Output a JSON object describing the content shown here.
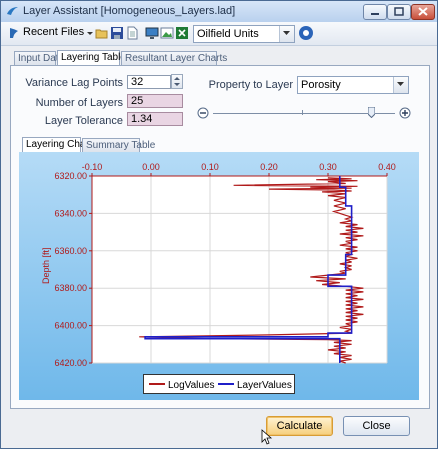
{
  "window": {
    "title": "Layer Assistant [Homogeneous_Layers.lad]"
  },
  "toolbar": {
    "recent_files_label": "Recent Files",
    "units_value": "Oilfield Units"
  },
  "main_tabs": [
    "Input Data",
    "Layering Tables",
    "Resultant Layer Charts"
  ],
  "form": {
    "variance_lag_label": "Variance Lag Points",
    "variance_lag_value": "32",
    "num_layers_label": "Number of Layers",
    "num_layers_value": "25",
    "layer_tolerance_label": "Layer Tolerance",
    "layer_tolerance_value": "1.34",
    "property_label": "Property to Layer",
    "property_value": "Porosity",
    "slider_level": 0.87
  },
  "sub_tabs": [
    "Layering Chart",
    "Summary Table"
  ],
  "chart_data": {
    "type": "line",
    "ylabel": "Depth [ft]",
    "xlabel": "",
    "xlim": [
      -0.1,
      0.4
    ],
    "ylim": [
      6320,
      6420
    ],
    "y_inverted": true,
    "x_ticks": [
      "-0.10",
      "0.00",
      "0.10",
      "0.20",
      "0.30",
      "0.40"
    ],
    "y_ticks": [
      "6320.00",
      "6340.00",
      "6360.00",
      "6380.00",
      "6400.00",
      "6420.00"
    ],
    "grid": true,
    "legend_position": "bottom",
    "series": [
      {
        "name": "LogValues",
        "color": "#b01a1a",
        "points": [
          [
            0.3,
            6321
          ],
          [
            0.34,
            6321.5
          ],
          [
            0.28,
            6322
          ],
          [
            0.35,
            6322.5
          ],
          [
            0.3,
            6323
          ],
          [
            0.33,
            6324
          ],
          [
            0.14,
            6325
          ],
          [
            0.35,
            6325.5
          ],
          [
            0.27,
            6326
          ],
          [
            0.34,
            6326.5
          ],
          [
            0.2,
            6327
          ],
          [
            0.31,
            6327.5
          ],
          [
            0.34,
            6328
          ],
          [
            0.29,
            6328.5
          ],
          [
            0.33,
            6329.5
          ],
          [
            0.3,
            6330.5
          ],
          [
            0.33,
            6331.5
          ],
          [
            0.31,
            6333
          ],
          [
            0.33,
            6334.5
          ],
          [
            0.31,
            6336
          ],
          [
            0.33,
            6337.5
          ],
          [
            0.31,
            6339
          ],
          [
            0.33,
            6341
          ],
          [
            0.34,
            6342
          ],
          [
            0.33,
            6343
          ],
          [
            0.34,
            6344
          ],
          [
            0.32,
            6345
          ],
          [
            0.35,
            6346
          ],
          [
            0.33,
            6347
          ],
          [
            0.36,
            6348
          ],
          [
            0.33,
            6349
          ],
          [
            0.35,
            6350
          ],
          [
            0.32,
            6351
          ],
          [
            0.36,
            6352
          ],
          [
            0.33,
            6353
          ],
          [
            0.35,
            6354
          ],
          [
            0.33,
            6355
          ],
          [
            0.34,
            6356
          ],
          [
            0.32,
            6357
          ],
          [
            0.35,
            6358
          ],
          [
            0.33,
            6359
          ],
          [
            0.35,
            6360
          ],
          [
            0.33,
            6361
          ],
          [
            0.34,
            6362
          ],
          [
            0.33,
            6363
          ],
          [
            0.35,
            6364
          ],
          [
            0.33,
            6365
          ],
          [
            0.34,
            6366
          ],
          [
            0.32,
            6367
          ],
          [
            0.34,
            6368
          ],
          [
            0.33,
            6369
          ],
          [
            0.34,
            6370
          ],
          [
            0.32,
            6371
          ],
          [
            0.33,
            6372
          ],
          [
            0.3,
            6373
          ],
          [
            0.27,
            6374
          ],
          [
            0.33,
            6375
          ],
          [
            0.28,
            6376
          ],
          [
            0.32,
            6377
          ],
          [
            0.29,
            6378
          ],
          [
            0.33,
            6379
          ],
          [
            0.36,
            6380
          ],
          [
            0.33,
            6381
          ],
          [
            0.36,
            6382
          ],
          [
            0.33,
            6383
          ],
          [
            0.35,
            6384
          ],
          [
            0.33,
            6385
          ],
          [
            0.36,
            6386
          ],
          [
            0.33,
            6387
          ],
          [
            0.35,
            6388
          ],
          [
            0.33,
            6389
          ],
          [
            0.36,
            6390
          ],
          [
            0.33,
            6391
          ],
          [
            0.35,
            6392
          ],
          [
            0.33,
            6393
          ],
          [
            0.36,
            6394
          ],
          [
            0.33,
            6395
          ],
          [
            0.35,
            6396
          ],
          [
            0.33,
            6397
          ],
          [
            0.35,
            6398
          ],
          [
            0.33,
            6399
          ],
          [
            0.34,
            6400
          ],
          [
            0.32,
            6401
          ],
          [
            0.34,
            6402
          ],
          [
            0.33,
            6403
          ],
          [
            0.34,
            6404
          ],
          [
            0.2,
            6405
          ],
          [
            -0.02,
            6406
          ],
          [
            0.1,
            6407
          ],
          [
            0.3,
            6407.5
          ],
          [
            0.34,
            6408
          ],
          [
            0.31,
            6409
          ],
          [
            0.34,
            6410
          ],
          [
            0.31,
            6411
          ],
          [
            0.33,
            6412
          ],
          [
            0.3,
            6413
          ],
          [
            0.33,
            6414
          ],
          [
            0.31,
            6415
          ],
          [
            0.34,
            6416
          ],
          [
            0.32,
            6417
          ],
          [
            0.34,
            6418
          ],
          [
            0.32,
            6419
          ],
          [
            0.33,
            6420
          ]
        ]
      },
      {
        "name": "LayerValues",
        "color": "#1f1fc8",
        "points": [
          [
            0.32,
            6320
          ],
          [
            0.32,
            6326
          ],
          [
            0.33,
            6326
          ],
          [
            0.33,
            6336
          ],
          [
            0.34,
            6336
          ],
          [
            0.34,
            6362
          ],
          [
            0.33,
            6362
          ],
          [
            0.33,
            6373
          ],
          [
            0.3,
            6373
          ],
          [
            0.3,
            6379
          ],
          [
            0.34,
            6379
          ],
          [
            0.34,
            6404
          ],
          [
            0.3,
            6404
          ],
          [
            0.3,
            6406
          ],
          [
            -0.01,
            6406
          ],
          [
            -0.01,
            6407
          ],
          [
            0.32,
            6407
          ],
          [
            0.32,
            6420
          ]
        ]
      }
    ]
  },
  "buttons": {
    "calculate": "Calculate",
    "close": "Close"
  }
}
